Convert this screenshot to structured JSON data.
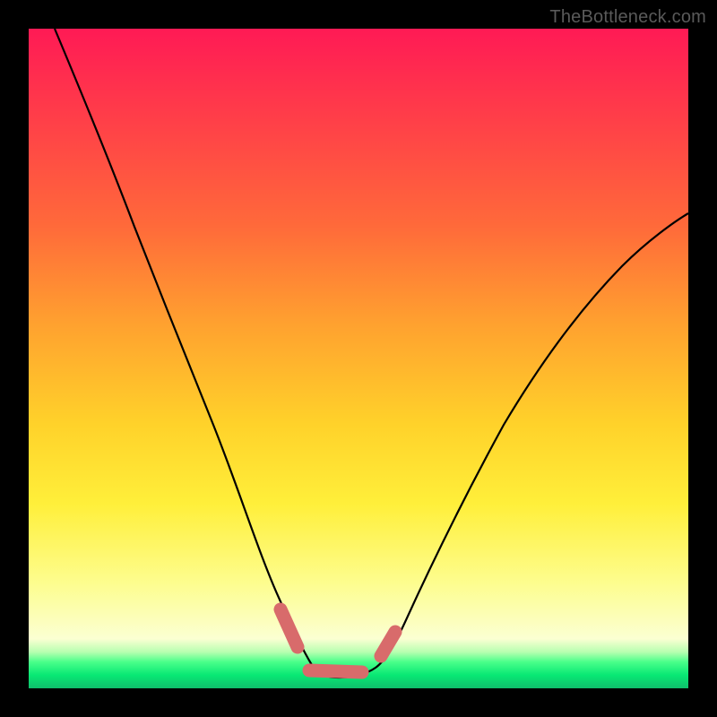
{
  "watermark": "TheBottleneck.com",
  "chart_data": {
    "type": "line",
    "title": "",
    "xlabel": "",
    "ylabel": "",
    "xlim": [
      0,
      100
    ],
    "ylim": [
      0,
      100
    ],
    "grid": false,
    "legend": false,
    "series": [
      {
        "name": "bottleneck-curve",
        "x": [
          4,
          8,
          12,
          16,
          20,
          24,
          28,
          32,
          36,
          38,
          40,
          42,
          44,
          46,
          48,
          50,
          52,
          55,
          58,
          62,
          66,
          70,
          75,
          80,
          85,
          90,
          95,
          100
        ],
        "y": [
          100,
          90,
          80,
          70,
          60,
          50,
          41,
          33,
          25,
          18,
          13,
          8,
          5,
          3,
          2,
          2,
          3,
          4,
          8,
          15,
          22,
          30,
          38,
          46,
          53,
          60,
          66,
          72
        ]
      }
    ],
    "markers": [
      {
        "name": "segment-a",
        "shape": "capsule",
        "color": "#d86b6b",
        "x": [
          38.5,
          41.5
        ],
        "y": [
          13,
          6
        ]
      },
      {
        "name": "segment-b",
        "shape": "capsule",
        "color": "#d86b6b",
        "x": [
          42.5,
          50.5
        ],
        "y": [
          3,
          2.5
        ]
      },
      {
        "name": "segment-c",
        "shape": "capsule",
        "color": "#d86b6b",
        "x": [
          53,
          55.5
        ],
        "y": [
          6,
          10
        ]
      }
    ],
    "gradient_stops": [
      {
        "pos": 0.0,
        "color": "#ff1a55"
      },
      {
        "pos": 0.3,
        "color": "#ff6a3a"
      },
      {
        "pos": 0.6,
        "color": "#ffd22a"
      },
      {
        "pos": 0.84,
        "color": "#fdfd8e"
      },
      {
        "pos": 0.96,
        "color": "#4aff8a"
      },
      {
        "pos": 1.0,
        "color": "#0fbf6c"
      }
    ]
  }
}
